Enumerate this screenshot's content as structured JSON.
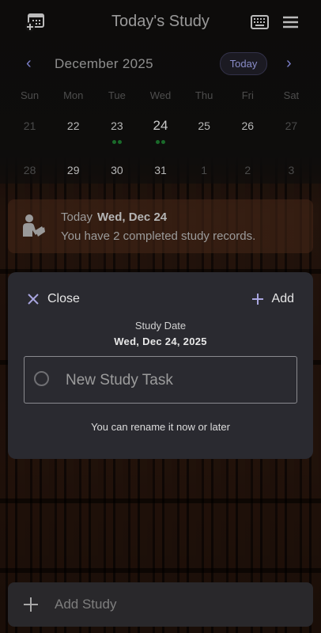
{
  "header": {
    "title": "Today's Study",
    "left_icon": "calendar-add-icon",
    "right_icons": [
      "keyboard-icon",
      "menu-icon"
    ]
  },
  "calendar": {
    "month_label": "December 2025",
    "today_label": "Today",
    "weekdays": [
      "Sun",
      "Mon",
      "Tue",
      "Wed",
      "Thu",
      "Fri",
      "Sat"
    ],
    "weeks": [
      [
        {
          "label": "21",
          "muted": true
        },
        {
          "label": "22"
        },
        {
          "label": "23",
          "dots": 2
        },
        {
          "label": "24",
          "selected": true,
          "dots": 2
        },
        {
          "label": "25"
        },
        {
          "label": "26"
        },
        {
          "label": "27",
          "muted": true
        }
      ],
      [
        {
          "label": "28",
          "muted": true
        },
        {
          "label": "29"
        },
        {
          "label": "30"
        },
        {
          "label": "31"
        },
        {
          "label": "1",
          "muted": true
        },
        {
          "label": "2",
          "muted": true
        },
        {
          "label": "3",
          "muted": true
        }
      ]
    ],
    "dot_color": "#1a6a2a"
  },
  "summary": {
    "today_tag": "Today",
    "date": "Wed, Dec 24",
    "message": "You have 2 completed study records."
  },
  "modal": {
    "close_label": "Close",
    "add_label": "Add",
    "study_date_label": "Study Date",
    "study_date_value": "Wed, Dec 24, 2025",
    "task_placeholder": "New Study Task",
    "hint": "You can rename it now or later"
  },
  "bottom_bar": {
    "label": "Add Study"
  },
  "colors": {
    "accent": "#7a7ec8",
    "modal_bg": "#2a2a30"
  }
}
